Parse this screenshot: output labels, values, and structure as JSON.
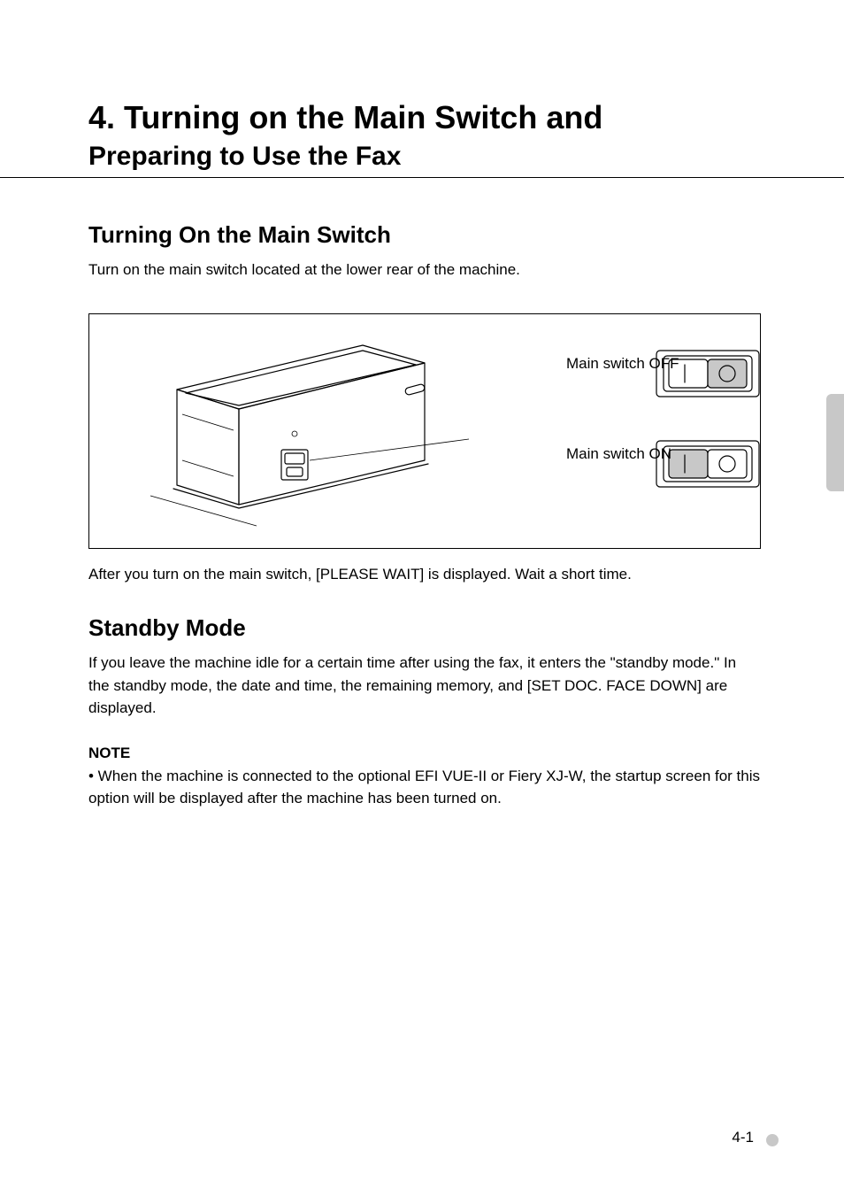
{
  "title": "4. Turning on the Main Switch and",
  "subtitle": "Preparing to Use the Fax",
  "section_label": "Turning On the Main Switch",
  "intro_text": "Turn on the main switch located at the lower rear of the machine.",
  "callout_off": "Main switch OFF",
  "callout_on": "Main switch ON",
  "post_line": "After you turn on the main switch, [PLEASE WAIT] is displayed. Wait a short time.",
  "standby_label": "Standby Mode",
  "standby_para": "If you leave the machine idle for a certain time after using the fax, it enters the \"standby mode.\" In the standby mode, the date and time, the remaining memory, and [SET DOC. FACE DOWN] are displayed.",
  "note_label": "NOTE",
  "note_bullet": "• When the machine is connected to the optional EFI VUE-II or Fiery XJ-W, the startup screen for this option will be displayed after the machine has been turned on.",
  "page_number": "4-1"
}
